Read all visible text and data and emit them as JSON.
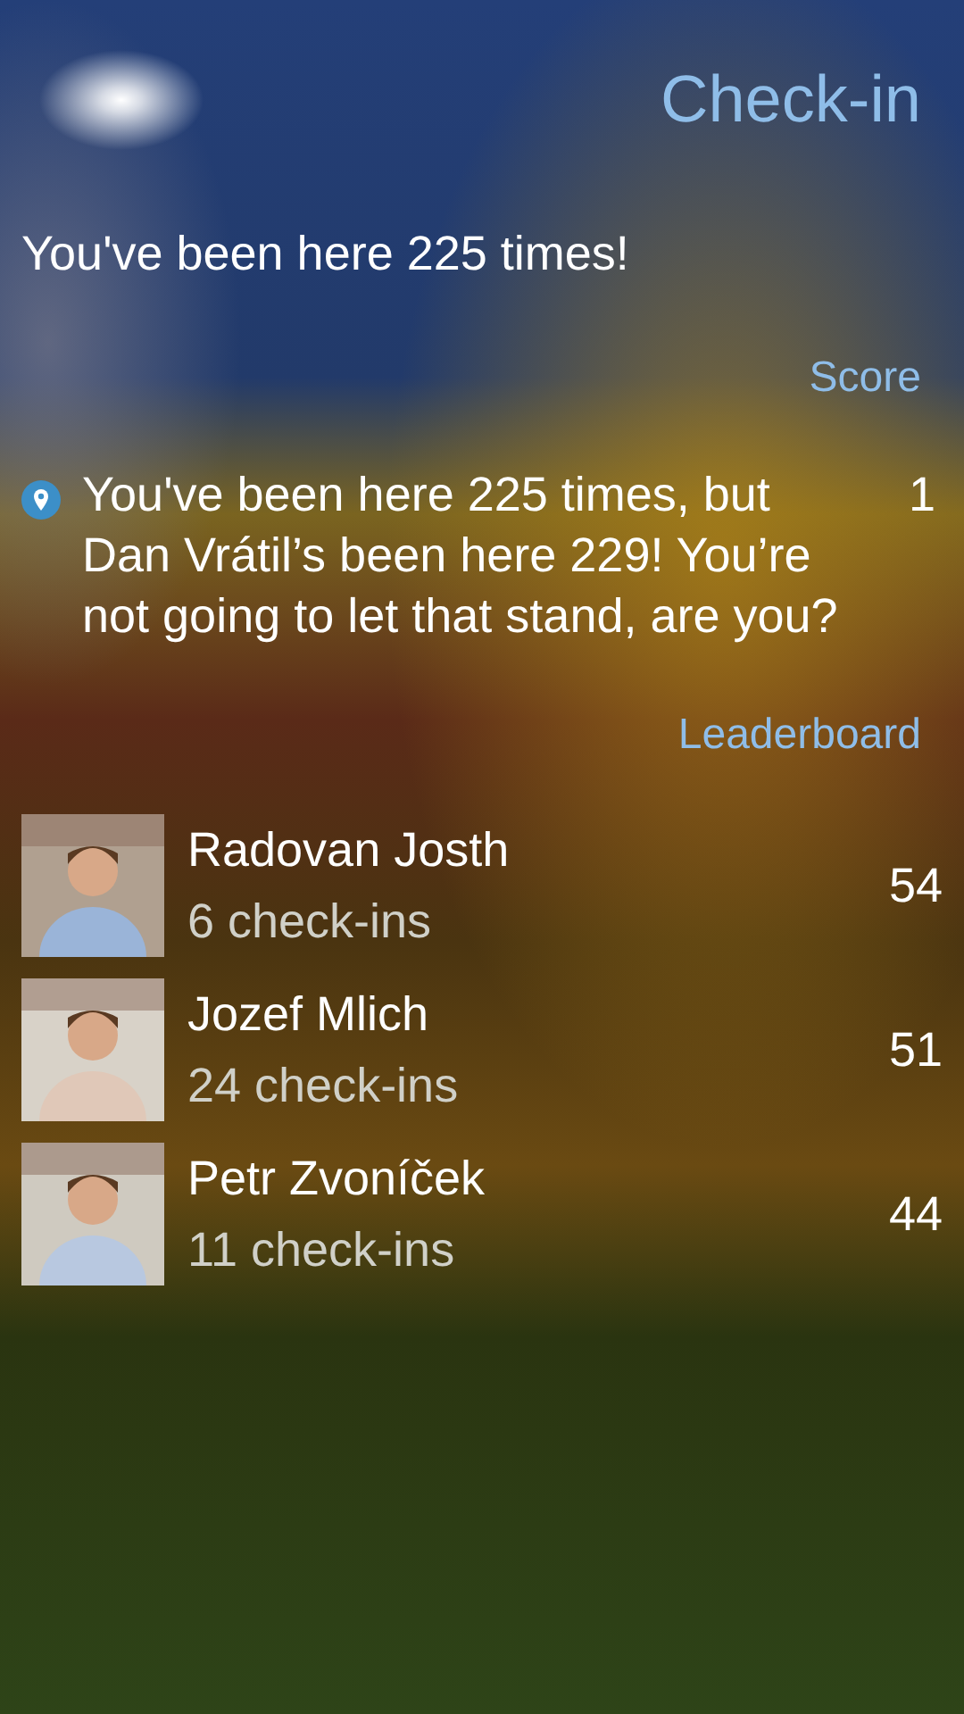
{
  "header": {
    "title": "Check-in"
  },
  "summary": "You've been here 225 times!",
  "score": {
    "heading": "Score",
    "items": [
      {
        "text": "You've been here 225 times, but Dan Vrátil’s been here 229! You’re not going to let that stand, are you?",
        "points": "1"
      }
    ]
  },
  "leaderboard": {
    "heading": "Leaderboard",
    "entries": [
      {
        "name": "Radovan Josth",
        "checkins": "6 check-ins",
        "score": "54"
      },
      {
        "name": "Jozef Mlich",
        "checkins": "24 check-ins",
        "score": "51"
      },
      {
        "name": "Petr Zvoníček",
        "checkins": "11 check-ins",
        "score": "44"
      }
    ]
  }
}
